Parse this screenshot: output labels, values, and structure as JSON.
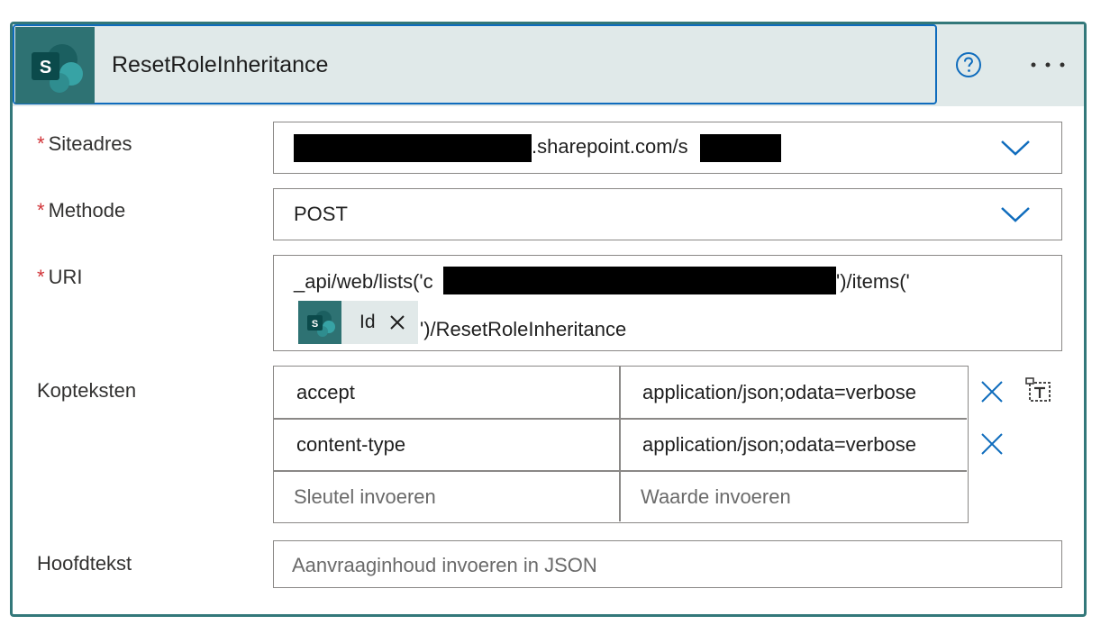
{
  "action": {
    "title": "ResetRoleInheritance",
    "app_icon": "sharepoint-icon",
    "help_icon": "help-circle-icon",
    "more_icon": "ellipsis-icon"
  },
  "colors": {
    "card_border": "#33787a",
    "header_bg": "#e0e9e9",
    "title_border": "#0f6cbd",
    "sharepoint_teal": "#2e7273",
    "required_star": "#d13438",
    "accent_blue": "#0f6cbd"
  },
  "site": {
    "required_mark": "*",
    "label": "Siteadres",
    "value_visible": ".sharepoint.com/s"
  },
  "method": {
    "required_mark": "*",
    "label": "Methode",
    "value": "POST"
  },
  "uri": {
    "required_mark": "*",
    "label": "URI",
    "line1_prefix": "_api/web/lists('c",
    "line1_suffix": "')/items('",
    "token_label": "Id",
    "line2_suffix": "')/ResetRoleInheritance"
  },
  "headers": {
    "label": "Kopteksten",
    "rows": [
      {
        "key": "accept",
        "value": "application/json;odata=verbose"
      },
      {
        "key": "content-type",
        "value": "application/json;odata=verbose"
      }
    ],
    "key_placeholder": "Sleutel invoeren",
    "value_placeholder": "Waarde invoeren"
  },
  "body": {
    "label": "Hoofdtekst",
    "placeholder": "Aanvraaginhoud invoeren in JSON"
  }
}
